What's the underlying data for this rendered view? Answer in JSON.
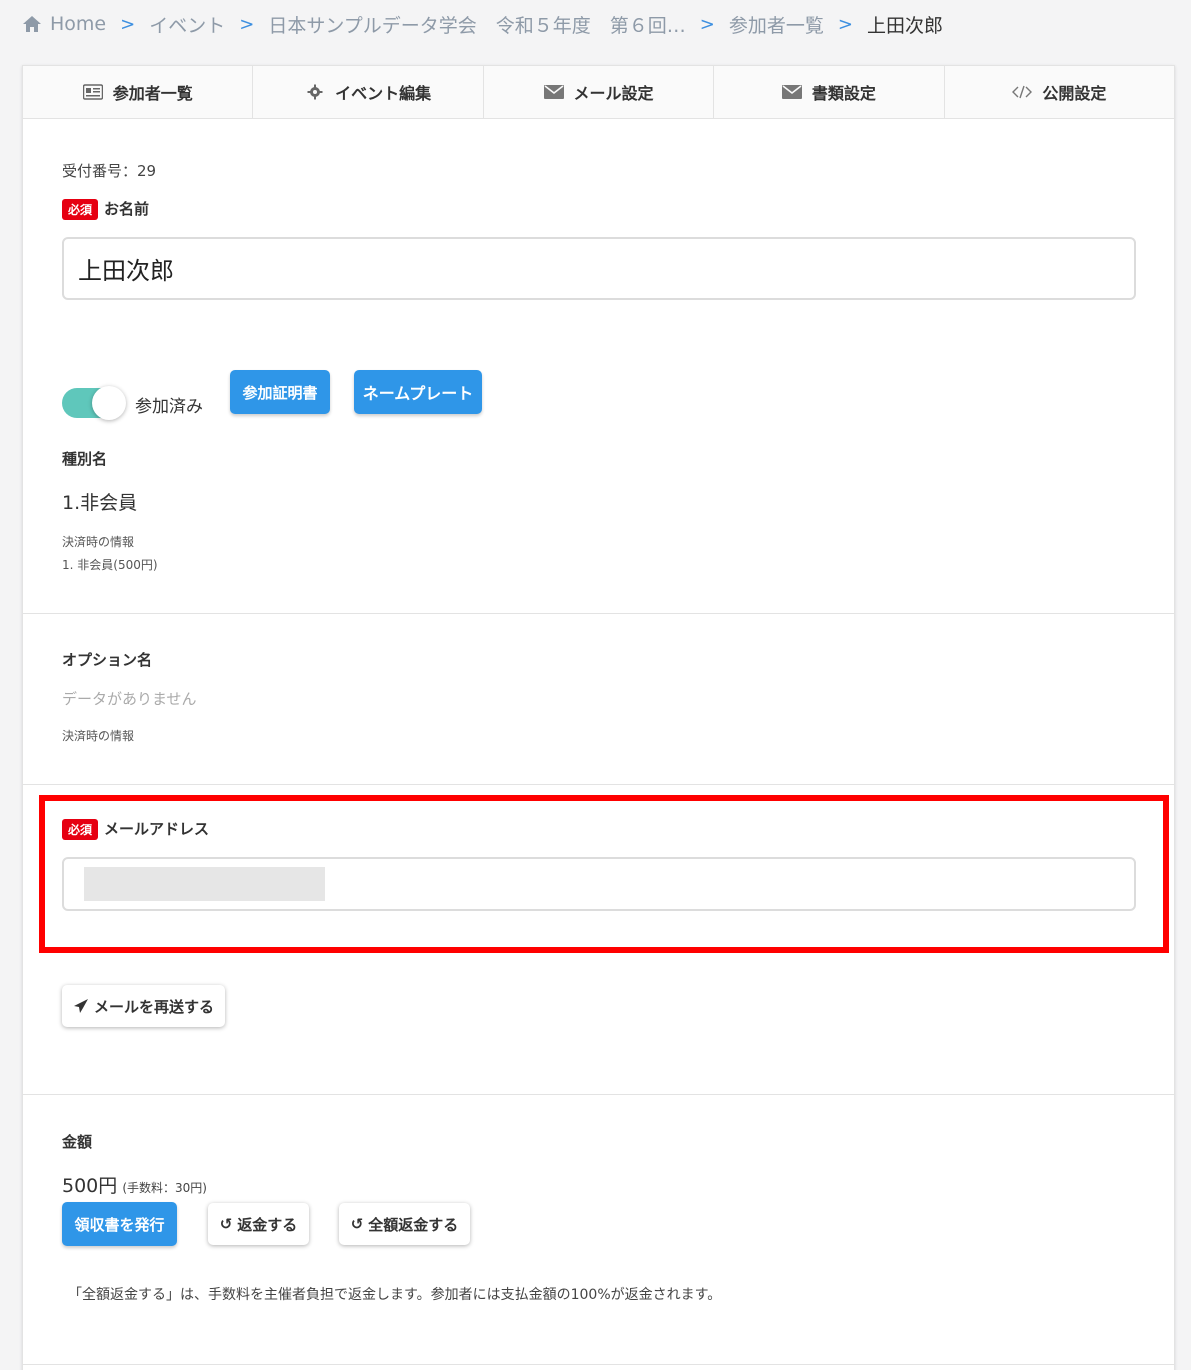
{
  "breadcrumb": {
    "home": "Home",
    "event": "イベント",
    "event_name": "日本サンプルデータ学会　令和５年度　第６回…",
    "participants": "参加者一覧",
    "current": "上田次郎"
  },
  "tabs": [
    {
      "label": "参加者一覧",
      "icon": "id-card-icon"
    },
    {
      "label": "イベント編集",
      "icon": "gear-icon"
    },
    {
      "label": "メール設定",
      "icon": "envelope-icon"
    },
    {
      "label": "書類設定",
      "icon": "envelope-icon"
    },
    {
      "label": "公開設定",
      "icon": "code-icon"
    }
  ],
  "reception": "受付番号：29",
  "required_badge": "必須",
  "name_field": {
    "label": "お名前",
    "value": "上田次郎"
  },
  "attendance": {
    "label": "参加済み",
    "checked": true
  },
  "buttons": {
    "certificate": "参加証明書",
    "nameplate": "ネームプレート",
    "resend": "メールを再送する",
    "receipt": "領収書を発行",
    "refund": "返金する",
    "full_refund": "全額返金する"
  },
  "category": {
    "label": "種別名",
    "value": "1.非会員",
    "payment_info_label": "決済時の情報",
    "payment_info_value": "1.  非会員(500円)"
  },
  "option": {
    "label": "オプション名",
    "empty": "データがありません",
    "payment_info_label": "決済時の情報"
  },
  "email_field": {
    "label": "メールアドレス",
    "value": ""
  },
  "amount": {
    "label": "金額",
    "value": "500円",
    "fee": "(手数料：30円)"
  },
  "note": "「全額返金する」は、手数料を主催者負担で返金します。参加者には支払金額の100%が返金されます。",
  "colors": {
    "accent": "#2f96e8",
    "required": "#e60012",
    "toggle": "#5fc7bb",
    "highlight": "#ff0000"
  }
}
